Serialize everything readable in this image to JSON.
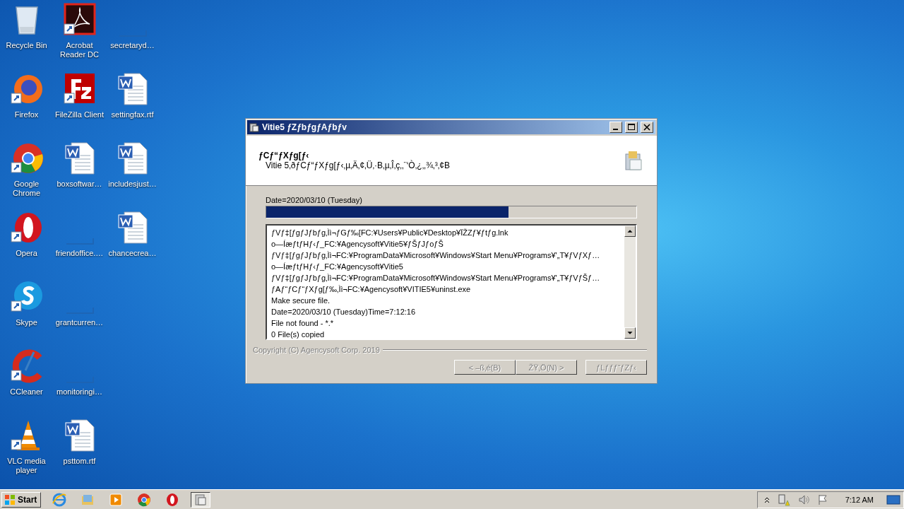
{
  "desktop_icons": [
    {
      "label": "Recycle Bin",
      "kind": "recycle"
    },
    {
      "label": "Firefox",
      "kind": "firefox"
    },
    {
      "label": "Google Chrome",
      "kind": "chrome"
    },
    {
      "label": "Opera",
      "kind": "opera"
    },
    {
      "label": "Skype",
      "kind": "skype"
    },
    {
      "label": "CCleaner",
      "kind": "ccleaner"
    },
    {
      "label": "VLC media player",
      "kind": "vlc"
    },
    {
      "label": "Acrobat Reader DC",
      "kind": "acrobat"
    },
    {
      "label": "FileZilla Client",
      "kind": "filezilla"
    },
    {
      "label": "boxsoftwar…",
      "kind": "word"
    },
    {
      "label": "friendoffice.…",
      "kind": "blank"
    },
    {
      "label": "grantcurren…",
      "kind": "blank"
    },
    {
      "label": "monitoringi…",
      "kind": "blank"
    },
    {
      "label": "psttom.rtf",
      "kind": "word"
    },
    {
      "label": "secretaryd…",
      "kind": "blank"
    },
    {
      "label": "settingfax.rtf",
      "kind": "word"
    },
    {
      "label": "includesjust…",
      "kind": "word"
    },
    {
      "label": "chancecrea…",
      "kind": "word"
    }
  ],
  "dialog": {
    "title": "Vitie5 ƒZƒbƒgƒAƒbƒv",
    "header_title": "ƒCƒ“ƒXƒg[ƒ‹",
    "header_subtitle": "Vitie 5‚ðƒCƒ“ƒXƒg[ƒ‹‚µ‚Ä‚¢‚Ü‚·B‚µ‚Î‚ç‚­‚¨‘Ò‚¿‚­‚¾‚³‚¢B",
    "status": "Date=2020/03/10 (Tuesday)",
    "progress": {
      "level": 0.655
    },
    "log": [
      "ƒVƒ‡[ƒgƒJƒbƒg‚Ìì¬ƒGƒ‰[FC:¥Users¥Public¥Desktop¥ÏŽZƒ¥ƒtƒg.lnk",
      "o—ÍæƒtƒHƒ‹ƒ_FC:¥Agencysoft¥Vitie5¥ƒŠƒJƒoƒŠ",
      "ƒVƒ‡[ƒgƒJƒbƒg‚Ìì¬FC:¥ProgramData¥Microsoft¥Windows¥Start Menu¥Programs¥'„T¥ƒVƒXƒ…",
      "o—ÍæƒtƒHƒ‹ƒ_FC:¥Agencysoft¥Vitie5",
      "ƒVƒ‡[ƒgƒJƒbƒg‚Ìì¬FC:¥ProgramData¥Microsoft¥Windows¥Start Menu¥Programs¥'„T¥ƒVƒŠƒ…",
      "ƒAƒ“ƒCƒ“ƒXƒg[ƒ‰‚Ìì¬FC:¥Agencysoft¥VITIE5¥uninst.exe",
      "Make secure file.",
      "Date=2020/03/10 (Tuesday)Time=7:12:16",
      "File not found - *.*",
      "0 File(s) copied"
    ],
    "copyright": "Copyright (C) Agencysoft Corp. 2019",
    "buttons": [
      {
        "label": "< –ß‚é(B)",
        "disabled": true
      },
      {
        "label": "ŽŸ‚Ö(N) >",
        "disabled": true
      },
      {
        "label": "ƒLƒƒƒ“ƒZƒ‹",
        "disabled": true
      }
    ]
  },
  "taskbar": {
    "start": "Start",
    "apps": [
      {
        "kind": "ie",
        "selected": false
      },
      {
        "kind": "explorer",
        "selected": false
      },
      {
        "kind": "media",
        "selected": false
      },
      {
        "kind": "chrome",
        "selected": false
      },
      {
        "kind": "opera",
        "selected": false
      },
      {
        "kind": "installer",
        "selected": true
      }
    ],
    "clock": "7:12 AM"
  }
}
